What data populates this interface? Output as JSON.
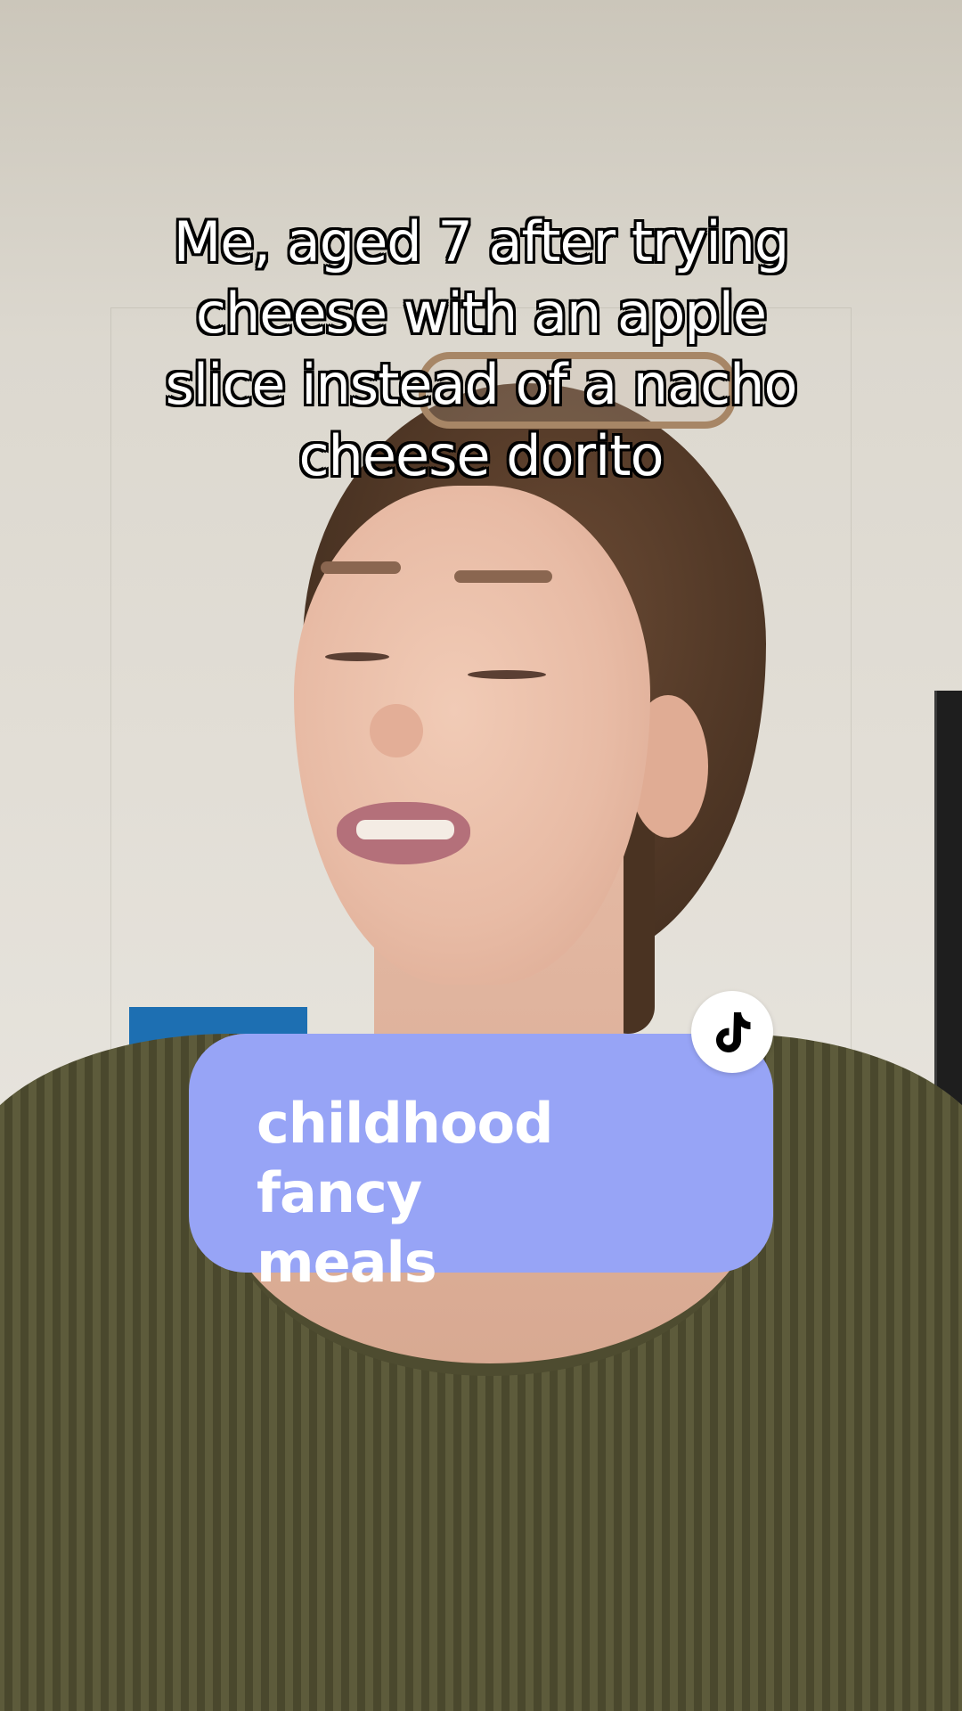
{
  "caption": {
    "lines": [
      "Me, aged 7 after trying",
      "cheese with an apple",
      "slice instead of a nacho",
      "cheese dorito"
    ]
  },
  "sticker": {
    "lines": [
      "childhood fancy",
      "meals"
    ],
    "color": "#97a4f6"
  },
  "badge": {
    "icon": "tiktok-logo-icon"
  }
}
